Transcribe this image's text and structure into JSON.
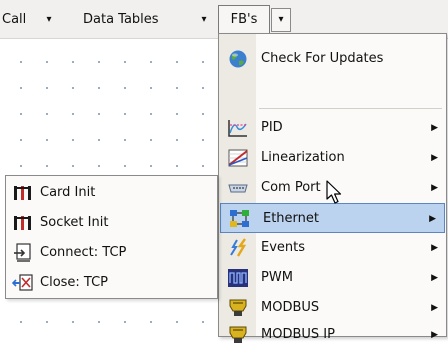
{
  "menubar": {
    "items": [
      {
        "label": "Call",
        "arrow": "▾"
      },
      {
        "label": "Data Tables",
        "arrow": "▾"
      }
    ],
    "active": {
      "label": "FB's",
      "arrow": "▾"
    }
  },
  "fb_menu": {
    "items": [
      {
        "label": "Check For Updates",
        "icon": "globe-icon",
        "submenu": false
      },
      {
        "label": "PID",
        "icon": "pid-chart-icon",
        "submenu": true
      },
      {
        "label": "Linearization",
        "icon": "linearization-graph-icon",
        "submenu": true
      },
      {
        "label": "Com Port",
        "icon": "serial-port-icon",
        "submenu": true
      },
      {
        "label": "Ethernet",
        "icon": "ethernet-network-icon",
        "submenu": true,
        "highlighted": true
      },
      {
        "label": "Events",
        "icon": "events-bolt-icon",
        "submenu": true
      },
      {
        "label": "PWM",
        "icon": "pwm-waveform-icon",
        "submenu": true
      },
      {
        "label": "MODBUS",
        "icon": "modbus-plug-icon",
        "submenu": true
      },
      {
        "label": "MODBUS IP",
        "icon": "modbus-ip-plug-icon",
        "submenu": true
      }
    ],
    "submenu_arrow": "▶"
  },
  "ethernet_submenu": {
    "items": [
      {
        "label": "Card Init",
        "icon": "tcp-block-icon"
      },
      {
        "label": "Socket Init",
        "icon": "tcp-block-icon"
      },
      {
        "label": "Connect: TCP",
        "icon": "connect-block-icon"
      },
      {
        "label": "Close: TCP",
        "icon": "close-block-icon"
      }
    ]
  },
  "colors": {
    "highlight": "#bcd3ef",
    "highlight_border": "#5a86c4",
    "menu_bg": "#fbfaf8",
    "gutter": "#edeae4"
  }
}
